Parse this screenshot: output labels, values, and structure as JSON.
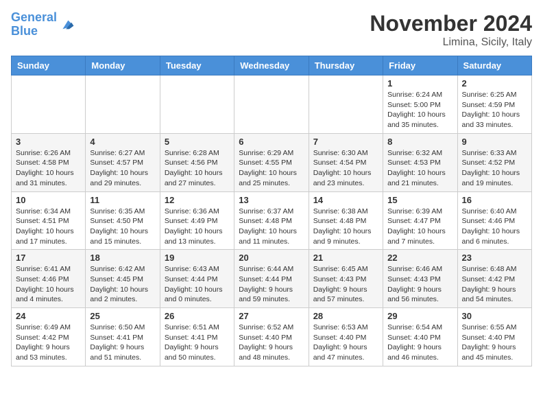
{
  "header": {
    "logo_line1": "General",
    "logo_line2": "Blue",
    "month_title": "November 2024",
    "location": "Limina, Sicily, Italy"
  },
  "weekdays": [
    "Sunday",
    "Monday",
    "Tuesday",
    "Wednesday",
    "Thursday",
    "Friday",
    "Saturday"
  ],
  "weeks": [
    [
      {
        "day": "",
        "info": ""
      },
      {
        "day": "",
        "info": ""
      },
      {
        "day": "",
        "info": ""
      },
      {
        "day": "",
        "info": ""
      },
      {
        "day": "",
        "info": ""
      },
      {
        "day": "1",
        "info": "Sunrise: 6:24 AM\nSunset: 5:00 PM\nDaylight: 10 hours\nand 35 minutes."
      },
      {
        "day": "2",
        "info": "Sunrise: 6:25 AM\nSunset: 4:59 PM\nDaylight: 10 hours\nand 33 minutes."
      }
    ],
    [
      {
        "day": "3",
        "info": "Sunrise: 6:26 AM\nSunset: 4:58 PM\nDaylight: 10 hours\nand 31 minutes."
      },
      {
        "day": "4",
        "info": "Sunrise: 6:27 AM\nSunset: 4:57 PM\nDaylight: 10 hours\nand 29 minutes."
      },
      {
        "day": "5",
        "info": "Sunrise: 6:28 AM\nSunset: 4:56 PM\nDaylight: 10 hours\nand 27 minutes."
      },
      {
        "day": "6",
        "info": "Sunrise: 6:29 AM\nSunset: 4:55 PM\nDaylight: 10 hours\nand 25 minutes."
      },
      {
        "day": "7",
        "info": "Sunrise: 6:30 AM\nSunset: 4:54 PM\nDaylight: 10 hours\nand 23 minutes."
      },
      {
        "day": "8",
        "info": "Sunrise: 6:32 AM\nSunset: 4:53 PM\nDaylight: 10 hours\nand 21 minutes."
      },
      {
        "day": "9",
        "info": "Sunrise: 6:33 AM\nSunset: 4:52 PM\nDaylight: 10 hours\nand 19 minutes."
      }
    ],
    [
      {
        "day": "10",
        "info": "Sunrise: 6:34 AM\nSunset: 4:51 PM\nDaylight: 10 hours\nand 17 minutes."
      },
      {
        "day": "11",
        "info": "Sunrise: 6:35 AM\nSunset: 4:50 PM\nDaylight: 10 hours\nand 15 minutes."
      },
      {
        "day": "12",
        "info": "Sunrise: 6:36 AM\nSunset: 4:49 PM\nDaylight: 10 hours\nand 13 minutes."
      },
      {
        "day": "13",
        "info": "Sunrise: 6:37 AM\nSunset: 4:48 PM\nDaylight: 10 hours\nand 11 minutes."
      },
      {
        "day": "14",
        "info": "Sunrise: 6:38 AM\nSunset: 4:48 PM\nDaylight: 10 hours\nand 9 minutes."
      },
      {
        "day": "15",
        "info": "Sunrise: 6:39 AM\nSunset: 4:47 PM\nDaylight: 10 hours\nand 7 minutes."
      },
      {
        "day": "16",
        "info": "Sunrise: 6:40 AM\nSunset: 4:46 PM\nDaylight: 10 hours\nand 6 minutes."
      }
    ],
    [
      {
        "day": "17",
        "info": "Sunrise: 6:41 AM\nSunset: 4:46 PM\nDaylight: 10 hours\nand 4 minutes."
      },
      {
        "day": "18",
        "info": "Sunrise: 6:42 AM\nSunset: 4:45 PM\nDaylight: 10 hours\nand 2 minutes."
      },
      {
        "day": "19",
        "info": "Sunrise: 6:43 AM\nSunset: 4:44 PM\nDaylight: 10 hours\nand 0 minutes."
      },
      {
        "day": "20",
        "info": "Sunrise: 6:44 AM\nSunset: 4:44 PM\nDaylight: 9 hours\nand 59 minutes."
      },
      {
        "day": "21",
        "info": "Sunrise: 6:45 AM\nSunset: 4:43 PM\nDaylight: 9 hours\nand 57 minutes."
      },
      {
        "day": "22",
        "info": "Sunrise: 6:46 AM\nSunset: 4:43 PM\nDaylight: 9 hours\nand 56 minutes."
      },
      {
        "day": "23",
        "info": "Sunrise: 6:48 AM\nSunset: 4:42 PM\nDaylight: 9 hours\nand 54 minutes."
      }
    ],
    [
      {
        "day": "24",
        "info": "Sunrise: 6:49 AM\nSunset: 4:42 PM\nDaylight: 9 hours\nand 53 minutes."
      },
      {
        "day": "25",
        "info": "Sunrise: 6:50 AM\nSunset: 4:41 PM\nDaylight: 9 hours\nand 51 minutes."
      },
      {
        "day": "26",
        "info": "Sunrise: 6:51 AM\nSunset: 4:41 PM\nDaylight: 9 hours\nand 50 minutes."
      },
      {
        "day": "27",
        "info": "Sunrise: 6:52 AM\nSunset: 4:40 PM\nDaylight: 9 hours\nand 48 minutes."
      },
      {
        "day": "28",
        "info": "Sunrise: 6:53 AM\nSunset: 4:40 PM\nDaylight: 9 hours\nand 47 minutes."
      },
      {
        "day": "29",
        "info": "Sunrise: 6:54 AM\nSunset: 4:40 PM\nDaylight: 9 hours\nand 46 minutes."
      },
      {
        "day": "30",
        "info": "Sunrise: 6:55 AM\nSunset: 4:40 PM\nDaylight: 9 hours\nand 45 minutes."
      }
    ]
  ]
}
